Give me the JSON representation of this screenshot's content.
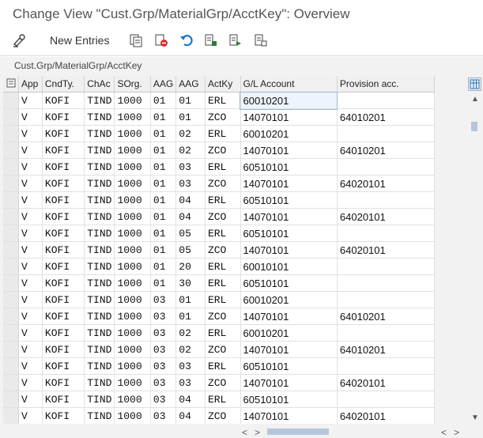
{
  "title": "Change View \"Cust.Grp/MaterialGrp/AcctKey\": Overview",
  "toolbar": {
    "new_entries_label": "New Entries"
  },
  "panel_title": "Cust.Grp/MaterialGrp/AcctKey",
  "columns": [
    "App",
    "CndTy.",
    "ChAc",
    "SOrg.",
    "AAG",
    "AAG",
    "ActKy",
    "G/L Account",
    "Provision acc."
  ],
  "rows": [
    [
      "V",
      "KOFI",
      "TIND",
      "1000",
      "01",
      "01",
      "ERL",
      "60010201",
      ""
    ],
    [
      "V",
      "KOFI",
      "TIND",
      "1000",
      "01",
      "01",
      "ZCO",
      "14070101",
      "64010201"
    ],
    [
      "V",
      "KOFI",
      "TIND",
      "1000",
      "01",
      "02",
      "ERL",
      "60010201",
      ""
    ],
    [
      "V",
      "KOFI",
      "TIND",
      "1000",
      "01",
      "02",
      "ZCO",
      "14070101",
      "64010201"
    ],
    [
      "V",
      "KOFI",
      "TIND",
      "1000",
      "01",
      "03",
      "ERL",
      "60510101",
      ""
    ],
    [
      "V",
      "KOFI",
      "TIND",
      "1000",
      "01",
      "03",
      "ZCO",
      "14070101",
      "64020101"
    ],
    [
      "V",
      "KOFI",
      "TIND",
      "1000",
      "01",
      "04",
      "ERL",
      "60510101",
      ""
    ],
    [
      "V",
      "KOFI",
      "TIND",
      "1000",
      "01",
      "04",
      "ZCO",
      "14070101",
      "64020101"
    ],
    [
      "V",
      "KOFI",
      "TIND",
      "1000",
      "01",
      "05",
      "ERL",
      "60510101",
      ""
    ],
    [
      "V",
      "KOFI",
      "TIND",
      "1000",
      "01",
      "05",
      "ZCO",
      "14070101",
      "64020101"
    ],
    [
      "V",
      "KOFI",
      "TIND",
      "1000",
      "01",
      "20",
      "ERL",
      "60010101",
      ""
    ],
    [
      "V",
      "KOFI",
      "TIND",
      "1000",
      "01",
      "30",
      "ERL",
      "60510101",
      ""
    ],
    [
      "V",
      "KOFI",
      "TIND",
      "1000",
      "03",
      "01",
      "ERL",
      "60010201",
      ""
    ],
    [
      "V",
      "KOFI",
      "TIND",
      "1000",
      "03",
      "01",
      "ZCO",
      "14070101",
      "64010201"
    ],
    [
      "V",
      "KOFI",
      "TIND",
      "1000",
      "03",
      "02",
      "ERL",
      "60010201",
      ""
    ],
    [
      "V",
      "KOFI",
      "TIND",
      "1000",
      "03",
      "02",
      "ZCO",
      "14070101",
      "64010201"
    ],
    [
      "V",
      "KOFI",
      "TIND",
      "1000",
      "03",
      "03",
      "ERL",
      "60510101",
      ""
    ],
    [
      "V",
      "KOFI",
      "TIND",
      "1000",
      "03",
      "03",
      "ZCO",
      "14070101",
      "64020101"
    ],
    [
      "V",
      "KOFI",
      "TIND",
      "1000",
      "03",
      "04",
      "ERL",
      "60510101",
      ""
    ],
    [
      "V",
      "KOFI",
      "TIND",
      "1000",
      "03",
      "04",
      "ZCO",
      "14070101",
      "64020101"
    ]
  ],
  "colors": {
    "accent": "#2a6fb0",
    "header_bg": "#f0f0f0",
    "panel_bg": "#f2f2f2"
  }
}
